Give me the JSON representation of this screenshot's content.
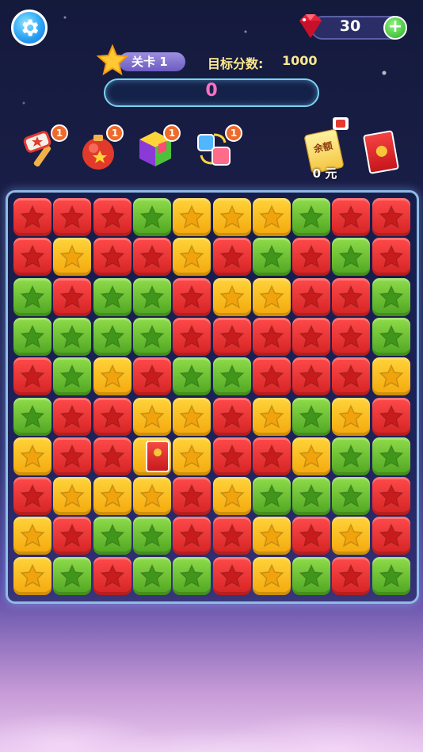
{
  "header": {
    "gem_count": "30",
    "level_label": "关卡 1",
    "target_label": "目标分数:",
    "target_value": "1000",
    "score": "0"
  },
  "tools": [
    {
      "name": "hammer",
      "count": "1"
    },
    {
      "name": "bomb",
      "count": "1"
    },
    {
      "name": "color-cube",
      "count": "1"
    },
    {
      "name": "swap",
      "count": "1"
    }
  ],
  "wallet": {
    "balance_card_label": "余额",
    "balance_text": "0 元"
  },
  "colors": {
    "red": "#e53333",
    "green": "#6cc432",
    "yellow": "#fbbc22"
  },
  "board": {
    "rows": [
      [
        "R",
        "R",
        "R",
        "G",
        "Y",
        "Y",
        "Y",
        "G",
        "R",
        "R"
      ],
      [
        "R",
        "Y",
        "R",
        "R",
        "Y",
        "R",
        "G",
        "R",
        "G",
        "R"
      ],
      [
        "G",
        "R",
        "G",
        "G",
        "R",
        "Y",
        "Y",
        "R",
        "R",
        "G"
      ],
      [
        "G",
        "G",
        "G",
        "G",
        "R",
        "R",
        "R",
        "R",
        "R",
        "G"
      ],
      [
        "R",
        "G",
        "Y",
        "R",
        "G",
        "G",
        "R",
        "R",
        "R",
        "Y"
      ],
      [
        "G",
        "R",
        "R",
        "Y",
        "Y",
        "R",
        "Y",
        "G",
        "Y",
        "R"
      ],
      [
        "Y",
        "R",
        "R",
        "E",
        "Y",
        "R",
        "R",
        "Y",
        "G",
        "G"
      ],
      [
        "R",
        "Y",
        "Y",
        "Y",
        "R",
        "Y",
        "G",
        "G",
        "G",
        "R"
      ],
      [
        "Y",
        "R",
        "G",
        "G",
        "R",
        "R",
        "Y",
        "R",
        "Y",
        "R"
      ],
      [
        "Y",
        "G",
        "R",
        "G",
        "G",
        "R",
        "Y",
        "G",
        "R",
        "G"
      ]
    ]
  }
}
